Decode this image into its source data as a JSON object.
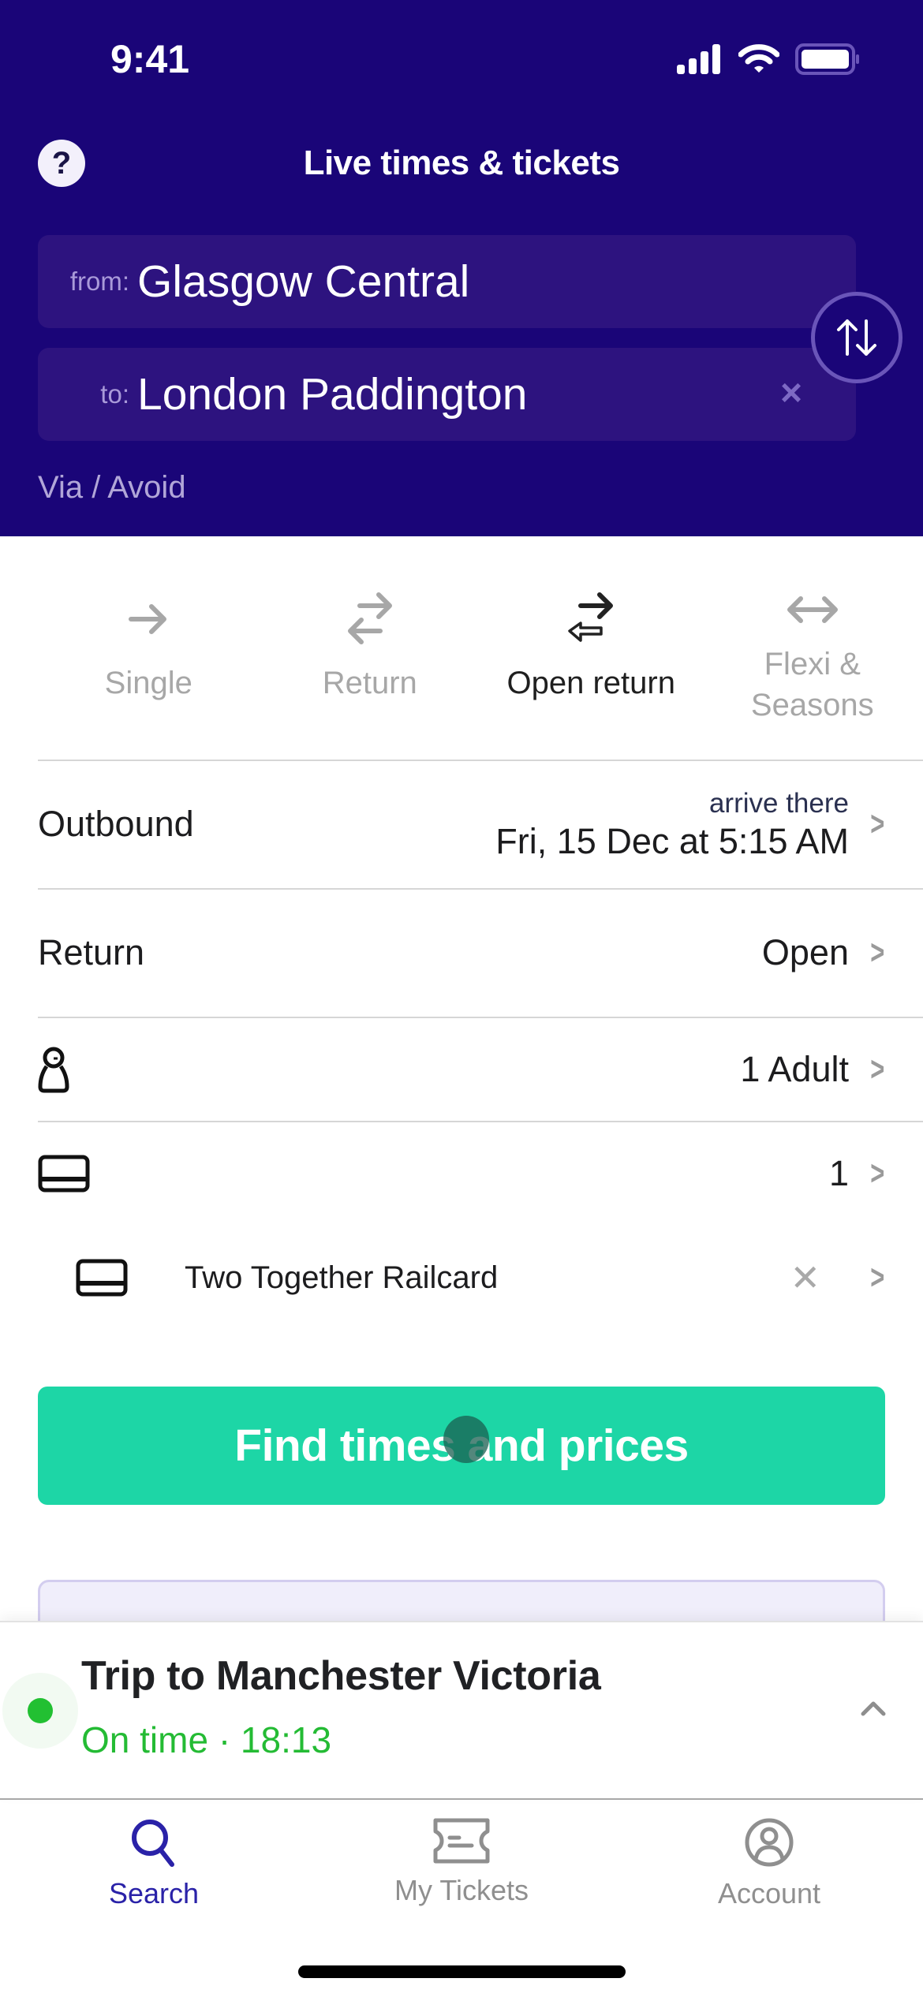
{
  "status_bar": {
    "time": "9:41"
  },
  "header": {
    "title": "Live times & tickets",
    "help_icon": "question-mark-icon",
    "from": {
      "label": "from:",
      "value": "Glasgow Central"
    },
    "to": {
      "label": "to:",
      "value": "London Paddington",
      "clear_icon": "close-icon"
    },
    "swap_icon": "swap-arrows-icon",
    "via_avoid": "Via / Avoid"
  },
  "trip_types": [
    {
      "label": "Single",
      "icon": "arrow-right-icon",
      "active": false
    },
    {
      "label": "Return",
      "icon": "return-arrows-icon",
      "active": false
    },
    {
      "label": "Open return",
      "icon": "open-return-arrows-icon",
      "active": true
    },
    {
      "label_line1": "Flexi &",
      "label_line2": "Seasons",
      "icon": "double-arrow-icon",
      "active": false
    }
  ],
  "outbound": {
    "label": "Outbound",
    "sublabel": "arrive there",
    "value": "Fri, 15 Dec at 5:15 AM"
  },
  "return_row": {
    "label": "Return",
    "value": "Open"
  },
  "passengers": {
    "icon": "person-icon",
    "value": "1 Adult"
  },
  "railcards": {
    "icon": "railcard-icon",
    "count": "1",
    "item": {
      "name": "Two Together Railcard",
      "remove_icon": "close-icon"
    }
  },
  "cta": {
    "label": "Find times and prices"
  },
  "trip_banner": {
    "title": "Trip to Manchester Victoria",
    "status": "On time · 18:13",
    "status_color": "#24bb34",
    "expand_icon": "chevron-up-icon"
  },
  "tab_bar": [
    {
      "label": "Search",
      "icon": "search-icon",
      "active": true
    },
    {
      "label": "My Tickets",
      "icon": "ticket-icon",
      "active": false
    },
    {
      "label": "Account",
      "icon": "account-icon",
      "active": false
    }
  ],
  "colors": {
    "header": "#1a0578",
    "field": "#2d137f",
    "cta": "#1dd6a6",
    "active_tab": "#2a22a8"
  }
}
